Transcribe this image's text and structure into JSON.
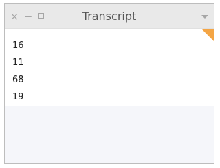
{
  "window": {
    "title": "Transcript",
    "controls": {
      "close": "×",
      "minimize": "−"
    }
  },
  "transcript": {
    "lines": [
      "16",
      "11",
      "68",
      "19"
    ]
  },
  "colors": {
    "accent_corner": "#f4a545",
    "titlebar": "#e9e9e9",
    "content_background": "#ffffff"
  }
}
